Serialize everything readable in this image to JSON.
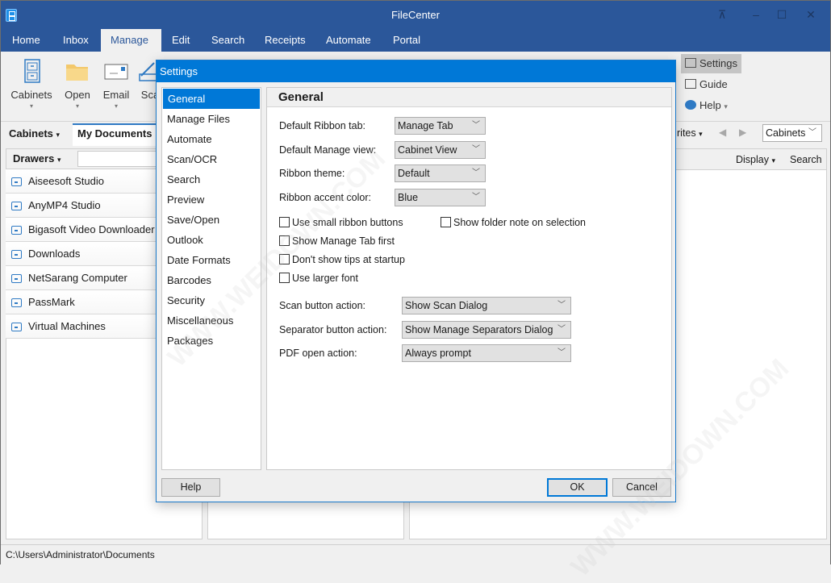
{
  "window": {
    "title": "FileCenter",
    "controls": [
      "restore-to-tray",
      "minimize",
      "maximize",
      "close"
    ]
  },
  "ribbon_tabs": [
    {
      "label": "Home",
      "active": false
    },
    {
      "label": "Inbox",
      "active": false
    },
    {
      "label": "Manage",
      "active": true
    },
    {
      "label": "Edit",
      "active": false
    },
    {
      "label": "Search",
      "active": false
    },
    {
      "label": "Receipts",
      "active": false
    },
    {
      "label": "Automate",
      "active": false
    },
    {
      "label": "Portal",
      "active": false
    }
  ],
  "ribbon": {
    "buttons": [
      {
        "label": "Cabinets",
        "icon": "cabinet-icon"
      },
      {
        "label": "Open",
        "icon": "folder-icon"
      },
      {
        "label": "Email",
        "icon": "envelope-icon"
      },
      {
        "label": "Sca",
        "icon": "scanner-icon"
      }
    ],
    "side": [
      {
        "label": "Settings",
        "icon": "settings-icon",
        "highlighted": true
      },
      {
        "label": "Guide",
        "icon": "book-icon"
      },
      {
        "label": "Help",
        "icon": "help-icon"
      }
    ],
    "dropdown_arrow": "▾",
    "collapse_glyph": "^"
  },
  "nav": {
    "cabinets_label": "Cabinets",
    "my_documents_tab": "My Documents",
    "favorites_label": "rites",
    "cabinets_select": "Cabinets",
    "display_label": "Display",
    "search_label": "Search"
  },
  "drawers": {
    "header": "Drawers",
    "search_value": "",
    "items": [
      "Aiseesoft Studio",
      "AnyMP4 Studio",
      "Bigasoft Video Downloader Pro",
      "Downloads",
      "NetSarang Computer",
      "PassMark",
      "Virtual Machines"
    ]
  },
  "status_bar": {
    "path": "C:\\Users\\Administrator\\Documents"
  },
  "settings_dialog": {
    "title": "Settings",
    "categories": [
      {
        "label": "General",
        "selected": true
      },
      {
        "label": "Manage Files"
      },
      {
        "label": "Automate"
      },
      {
        "label": "Scan/OCR"
      },
      {
        "label": "Search"
      },
      {
        "label": "Preview"
      },
      {
        "label": "Save/Open"
      },
      {
        "label": "Outlook"
      },
      {
        "label": "Date Formats"
      },
      {
        "label": "Barcodes"
      },
      {
        "label": "Security"
      },
      {
        "label": "Miscellaneous"
      },
      {
        "label": "Packages"
      }
    ],
    "section_title": "General",
    "fields": [
      {
        "label": "Default Ribbon tab:",
        "value": "Manage Tab"
      },
      {
        "label": "Default Manage view:",
        "value": "Cabinet View"
      },
      {
        "label": "Ribbon theme:",
        "value": "Default"
      },
      {
        "label": "Ribbon accent color:",
        "value": "Blue"
      }
    ],
    "checkboxes": [
      {
        "label": "Use small ribbon buttons",
        "checked": false
      },
      {
        "label": "Show folder note on selection",
        "checked": false
      },
      {
        "label": "Show Manage Tab first",
        "checked": false
      },
      {
        "label": "Don't show tips at startup",
        "checked": false
      },
      {
        "label": "Use larger font",
        "checked": false
      }
    ],
    "actions": [
      {
        "label": "Scan button action:",
        "value": "Show Scan Dialog"
      },
      {
        "label": "Separator button action:",
        "value": "Show Manage Separators Dialog"
      },
      {
        "label": "PDF open action:",
        "value": "Always prompt"
      }
    ],
    "buttons": {
      "help": "Help",
      "ok": "OK",
      "cancel": "Cancel"
    }
  },
  "colors": {
    "titlebar": "#2b579a",
    "dialog_accent": "#0078d7"
  },
  "watermark": "WWW.WEIDOWN.COM"
}
